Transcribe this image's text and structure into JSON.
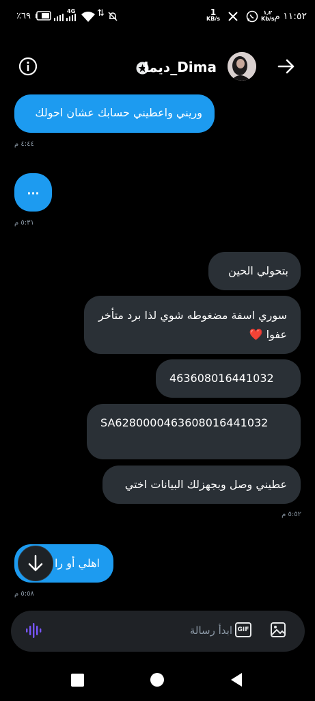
{
  "status_bar": {
    "time": "١١:٥٢ م",
    "speed_1": "١٫٢",
    "speed_1_unit": "Kb/s",
    "speed_2": "1",
    "speed_2_unit": "KB/s",
    "network": "4G",
    "battery": "٪٦٩"
  },
  "header": {
    "contact_name": "ديما_Dima"
  },
  "messages": [
    {
      "text": "وريني واعطيني حسابك عشان احولك",
      "side": "received",
      "time": "٤:٤٤ م"
    },
    {
      "text": "...",
      "side": "received",
      "time": "٥:٣١ م"
    },
    {
      "text": "بتحولي الحين",
      "side": "sent"
    },
    {
      "text": "سوري اسفة مضغوطه شوي لذا برد متأخر عفوا",
      "side": "sent"
    },
    {
      "text": "463608016441032",
      "side": "sent"
    },
    {
      "text": "SA6280000463608016441032",
      "side": "sent"
    },
    {
      "text": "عطيني وصل وبجهزلك البيانات اختي",
      "side": "sent",
      "time": "٥:٥٢ م"
    },
    {
      "text": "اهلي أو را",
      "side": "received",
      "time": "٥:٥٨ م"
    }
  ],
  "composer": {
    "placeholder": "ابدأ رسالة",
    "gif_label": "GIF"
  },
  "colors": {
    "received_bubble": "#1d9bf0",
    "sent_bubble": "#2a3036",
    "background": "#000000",
    "voice_icon": "#7856ff"
  }
}
